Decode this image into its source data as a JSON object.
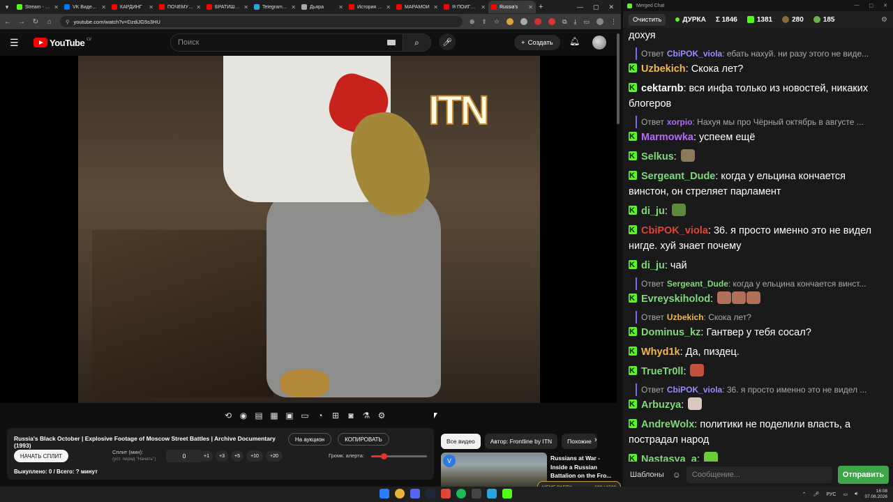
{
  "browser": {
    "tabs": [
      {
        "label": "Stream - Kic",
        "color": "#53fc18"
      },
      {
        "label": "VK Видео Li",
        "color": "#0077ff"
      },
      {
        "label": "КАРДИНГ",
        "color": "#ff0000"
      },
      {
        "label": "ПОЧЕМУ ПА",
        "color": "#ff0000"
      },
      {
        "label": "БРАТИШКИ",
        "color": "#ff0000"
      },
      {
        "label": "Telegram: V",
        "color": "#2aa3e0"
      },
      {
        "label": "Дьяра",
        "color": "#aaaaaa"
      },
      {
        "label": "История Ар",
        "color": "#ff0000"
      },
      {
        "label": "МАРАМОЙ",
        "color": "#ff0000"
      },
      {
        "label": "Я ПОИГРАЛ",
        "color": "#ff0000"
      },
      {
        "label": "Russia's",
        "color": "#ff0000"
      }
    ],
    "url": "youtube.com/watch?v=DzdiJG5s3HU"
  },
  "youtube": {
    "logo_text": "YouTube",
    "country_code": "LV",
    "search_placeholder": "Поиск",
    "create_label": "Создать",
    "video_overlay_text": "ITN",
    "video_title": "Russia's Black October | Explosive Footage of Moscow Street Battles | Archive Documentary (1993)",
    "auction_label": "На аукцион",
    "copy_label": "КОПИРОВАТЬ",
    "start_split_label": "НАЧАТЬ СПЛИТ",
    "split_label": "Сплит (мин):",
    "split_sub": "(уст. перед \"Начать\")",
    "split_value": "0",
    "increments": [
      "+1",
      "+3",
      "+5",
      "+10",
      "+20"
    ],
    "volume_label": "Громк. алерта:",
    "volume_level": 0.22,
    "bought_text": "Выкуплено: 0 / Всего: ? минут",
    "chips": [
      "Все видео",
      "Автор: Frontline by ITN",
      "Похожие"
    ],
    "rec_title": "Russians at War - Inside a Russian Battalion on the Fro...",
    "meme_label": "MEME PARTY",
    "meme_counter": "600 / 1500"
  },
  "taskbar": {
    "lang": "РУС",
    "time": "16:08",
    "date": "07.08.2026"
  },
  "chat": {
    "window_title": "Merged Chat",
    "clear_label": "Очистить",
    "channel": "ДУРКА",
    "total": "Σ 1846",
    "kick_count": "1381",
    "second_count": "280",
    "third_count": "185",
    "templates_label": "Шаблоны",
    "input_placeholder": "Сообщение...",
    "send_label": "Отправить",
    "messages": [
      {
        "type": "cont",
        "text": "дохуя"
      },
      {
        "type": "reply",
        "prefix": "Ответ",
        "name": "CbiPOK_viola",
        "color": "#9b8cff",
        "text": ": ебать нахуй. ни разу этого не виде..."
      },
      {
        "type": "msg",
        "name": "Uzbekich",
        "color": "#f0b84a",
        "text": ": Скока лет?"
      },
      {
        "type": "msg",
        "name": "cektarnb",
        "color": "#ffffff",
        "text": ": вся инфа только из новостей, никаких блогеров"
      },
      {
        "type": "reply",
        "prefix": "Ответ",
        "name": "xorpio",
        "color": "#b26cf5",
        "text": ": Нахуя мы про Чёрный октябрь в августе ..."
      },
      {
        "type": "msg",
        "name": "Marmowka",
        "color": "#b26cf5",
        "text": ": успеем ещё"
      },
      {
        "type": "msg",
        "name": "Selkus",
        "color": "#7fd97a",
        "text": ":",
        "emote": "#8a7a5a"
      },
      {
        "type": "msg",
        "name": "Sergeant_Dude",
        "color": "#7fd97a",
        "text": ": когда у ельцина кончается винстон, он стреляет парламент"
      },
      {
        "type": "msg",
        "name": "di_ju",
        "color": "#7fd97a",
        "text": ":",
        "emote": "#5b8a3a"
      },
      {
        "type": "msg",
        "name": "CbiPOK_viola",
        "color": "#e0453a",
        "text": ": 36. я просто именно это не видел нигде. хуй знает почему"
      },
      {
        "type": "msg",
        "name": "di_ju",
        "color": "#7fd97a",
        "text": ": чай"
      },
      {
        "type": "reply",
        "prefix": "Ответ",
        "name": "Sergeant_Dude",
        "color": "#7fd97a",
        "text": ": когда у ельцина кончается винст..."
      },
      {
        "type": "msg",
        "name": "Evreyskiholod",
        "color": "#7fd97a",
        "text": ":",
        "emote": "#b0705a",
        "emote_count": 3
      },
      {
        "type": "reply",
        "prefix": "Ответ",
        "name": "Uzbekich",
        "color": "#f0b84a",
        "text": ": Скока лет?"
      },
      {
        "type": "msg",
        "name": "Dominus_kz",
        "color": "#7fd97a",
        "text": ": Гантвер у тебя сосал?"
      },
      {
        "type": "msg",
        "name": "Whyd1k",
        "color": "#f0b84a",
        "text": ": Да, пиздец."
      },
      {
        "type": "msg",
        "name": "TrueTr0ll",
        "color": "#7fd97a",
        "text": ":",
        "emote": "#c4523a"
      },
      {
        "type": "reply",
        "prefix": "Ответ",
        "name": "CbiPOK_viola",
        "color": "#9b8cff",
        "text": ": 36. я просто именно это не видел ..."
      },
      {
        "type": "msg",
        "name": "Arbuzya",
        "color": "#7fd97a",
        "text": ":",
        "emote": "#d8c8c0"
      },
      {
        "type": "msg",
        "name": "AndreWolx",
        "color": "#7fd97a",
        "text": ": политики не поделили власть, а пострадал народ"
      },
      {
        "type": "msg",
        "name": "Nastasya_a",
        "color": "#7fd97a",
        "text": ":",
        "emote": "#6acb3a"
      }
    ]
  }
}
